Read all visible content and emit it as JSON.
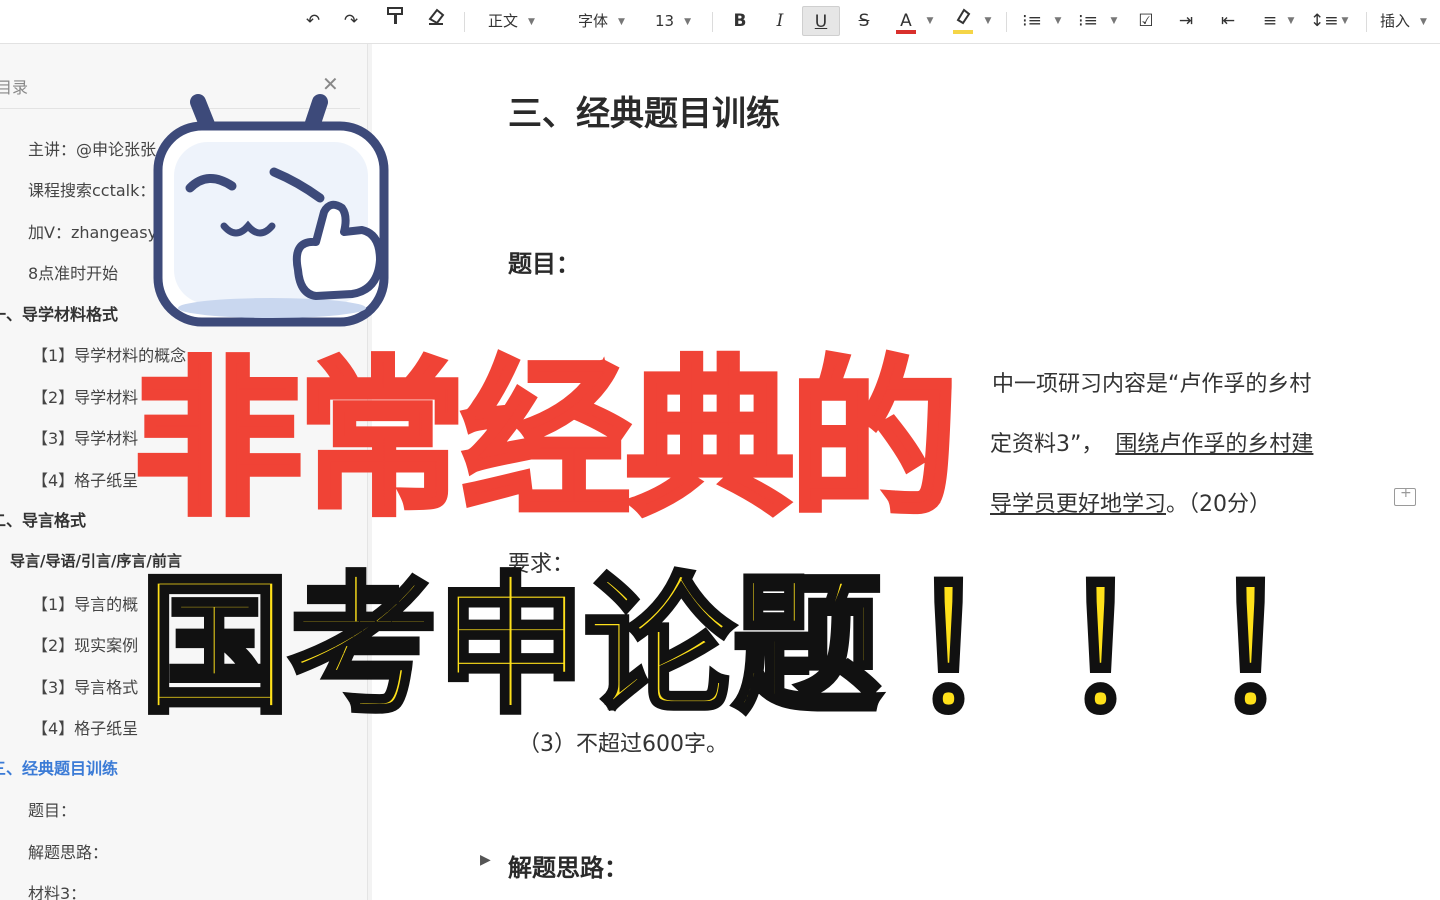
{
  "toolbar": {
    "style_label": "正文",
    "font_label": "字体",
    "size_label": "13",
    "bold": "B",
    "italic": "I",
    "underline": "U",
    "strike": "S",
    "font_color": "A",
    "insert_label": "插入"
  },
  "sidebar": {
    "title": "目录",
    "items": [
      {
        "text": "主讲：@申论张张"
      },
      {
        "text": "课程搜索cctalk："
      },
      {
        "text": "加V：zhangeasy"
      },
      {
        "text": "8点准时开始"
      },
      {
        "text": "一、导学材料格式"
      },
      {
        "text": "【1】导学材料的概念"
      },
      {
        "text": "【2】导学材料"
      },
      {
        "text": "【3】导学材料"
      },
      {
        "text": "【4】格子纸呈"
      },
      {
        "text": "二、导言格式"
      },
      {
        "text": "导言/导语/引言/序言/前言"
      },
      {
        "text": "【1】导言的概"
      },
      {
        "text": "【2】现实案例"
      },
      {
        "text": "【3】导言格式"
      },
      {
        "text": "【4】格子纸呈"
      },
      {
        "text": "三、经典题目训练"
      },
      {
        "text": "题目："
      },
      {
        "text": "解题思路："
      },
      {
        "text": "材料3："
      }
    ]
  },
  "document": {
    "title": "三、经典题目训练",
    "question_heading": "题目：",
    "line1": "中一项研习内容是“卢作孚的乡村",
    "line2_plain": "定资料3”，",
    "line2_underlined": "围绕卢作孚的乡村建",
    "line3_underlined": "导学员更好地学习",
    "line3_tail": "。（20分）",
    "requirements_label": "要求：",
    "req3": "（3）不超过600字。",
    "solution_heading": "解题思路："
  },
  "overlay": {
    "red_text": "非常经典的",
    "yellow_text": "国考申论题",
    "exclaim": "！"
  },
  "colors": {
    "overlay_red": "#f04336",
    "overlay_yellow": "#ffe11a",
    "toc_active": "#3b7bd6",
    "font_color_bar": "#d9302c",
    "highlight_bar": "#f5d547"
  }
}
